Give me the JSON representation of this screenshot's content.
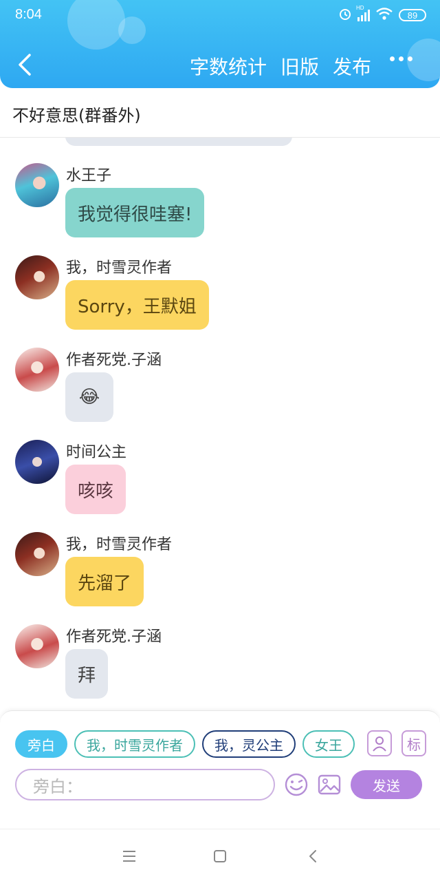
{
  "status_bar": {
    "time": "8:04",
    "battery": "89",
    "network_label": "HD"
  },
  "header": {
    "actions": [
      "字数统计",
      "旧版",
      "发布"
    ]
  },
  "story": {
    "title": "不好意思(群番外)"
  },
  "messages": [
    {
      "sender": "水王子",
      "text": "我觉得很哇塞!",
      "style": "teal"
    },
    {
      "sender": "我，时雪灵作者",
      "text": "Sorry，王默姐",
      "style": "yellow"
    },
    {
      "sender": "作者死党.子涵",
      "text": "😂",
      "style": "gray"
    },
    {
      "sender": "时间公主",
      "text": "咳咳",
      "style": "pink"
    },
    {
      "sender": "我，时雪灵作者",
      "text": "先溜了",
      "style": "yellow"
    },
    {
      "sender": "作者死党.子涵",
      "text": "拜",
      "style": "gray"
    }
  ],
  "composer": {
    "roles": [
      "旁白",
      "我，时雪灵作者",
      "我，灵公主",
      "女王"
    ],
    "tag_label": "标",
    "input_placeholder": "旁白：",
    "send_label": "发送"
  },
  "colors": {
    "header_blue": "#3bb6f3",
    "teal_bubble": "#86d5cd",
    "yellow_bubble": "#fcd660",
    "gray_bubble": "#e3e7ee",
    "pink_bubble": "#fbcfdb",
    "send_purple": "#b483e0"
  }
}
